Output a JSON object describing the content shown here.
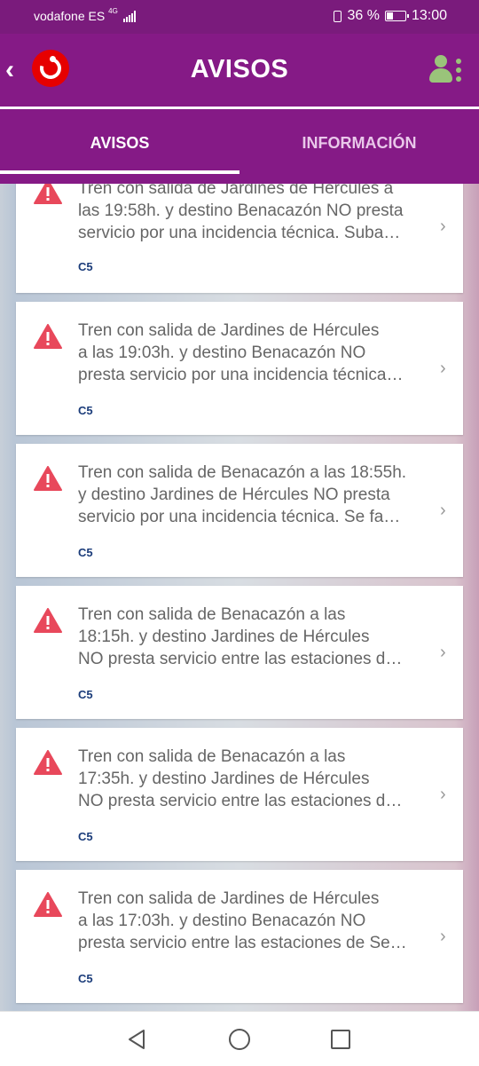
{
  "status_bar": {
    "carrier": "vodafone ES",
    "network": "4G",
    "battery_percent": "36 %",
    "battery_level": 0.36,
    "time": "13:00"
  },
  "header": {
    "title": "AVISOS",
    "logo": "vodafone-logo",
    "back_icon": "chevron-left-icon",
    "user_icon": "user-settings-icon",
    "accent_color": "#851a86",
    "alert_color": "#e8485b"
  },
  "tabs": [
    {
      "label": "AVISOS",
      "active": true
    },
    {
      "label": "INFORMACIÓN",
      "active": false
    }
  ],
  "notices": [
    {
      "lines": [
        "Tren con salida de Jardines de Hércules a",
        "las 19:58h. y destino Benacazón NO presta",
        "servicio por una incidencia técnica. Suba…"
      ],
      "line": "C5"
    },
    {
      "lines": [
        "Tren con salida de Jardines de Hércules",
        "a las 19:03h. y destino Benacazón NO",
        "presta servicio por una incidencia técnica…"
      ],
      "line": "C5"
    },
    {
      "lines": [
        "Tren con salida de Benacazón a las 18:55h.",
        "y destino Jardines de Hércules NO presta",
        "servicio por una incidencia técnica. Se fa…"
      ],
      "line": "C5"
    },
    {
      "lines": [
        "Tren con salida de Benacazón a las",
        "18:15h. y destino Jardines de Hércules",
        "NO presta servicio entre las estaciones d…"
      ],
      "line": "C5"
    },
    {
      "lines": [
        "Tren con salida de Benacazón a las",
        "17:35h. y destino Jardines de Hércules",
        "NO presta servicio entre las estaciones d…"
      ],
      "line": "C5"
    },
    {
      "lines": [
        "Tren con salida de Jardines de Hércules",
        "a las 17:03h. y destino Benacazón NO",
        "presta servicio entre las estaciones de Se…"
      ],
      "line": "C5"
    }
  ],
  "nav": {
    "back": "triangle-back-icon",
    "home": "circle-home-icon",
    "recents": "square-recents-icon"
  }
}
